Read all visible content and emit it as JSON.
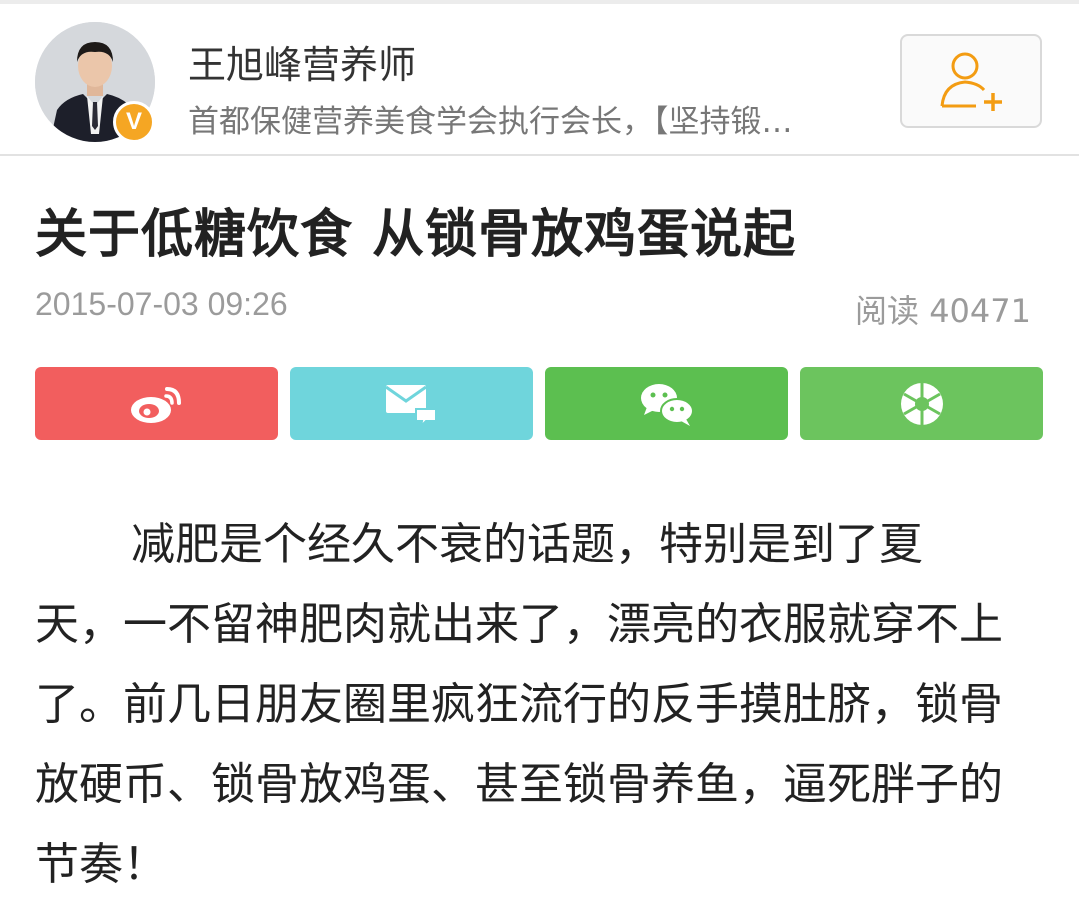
{
  "author": {
    "name": "王旭峰营养师",
    "description": "首都保健营养美食学会执行会长，【坚持锻…",
    "verified_badge": "V",
    "avatar_icon": "author-avatar-photo"
  },
  "follow": {
    "icon": "add-user-icon",
    "color": "#f39c12"
  },
  "article": {
    "title": "关于低糖饮食 从锁骨放鸡蛋说起",
    "date": "2015-07-03 09:26",
    "read_label": "阅读 40471",
    "body": "减肥是个经久不衰的话题，特别是到了夏天，一不留神肥肉就出来了，漂亮的衣服就穿不上了。前几日朋友圈里疯狂流行的反手摸肚脐，锁骨放硬币、锁骨放鸡蛋、甚至锁骨养鱼，逼死胖子的节奏！"
  },
  "share": [
    {
      "name": "weibo",
      "icon": "weibo-icon",
      "color": "#f25e5e"
    },
    {
      "name": "email",
      "icon": "mail-icon",
      "color": "#6fd5dc"
    },
    {
      "name": "wechat",
      "icon": "wechat-icon",
      "color": "#5cbf50"
    },
    {
      "name": "moments",
      "icon": "moments-icon",
      "color": "#6cc45e"
    }
  ]
}
